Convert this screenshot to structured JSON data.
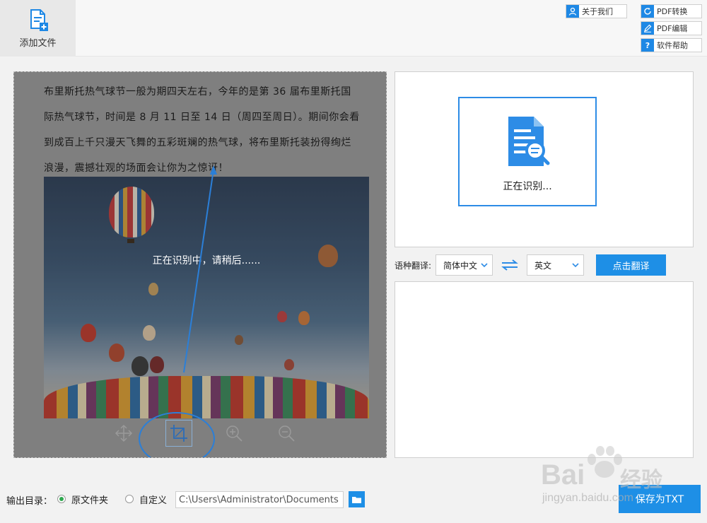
{
  "toolbar": {
    "add_file_label": "添加文件",
    "about_label": "关于我们",
    "pdf_convert_label": "PDF转换",
    "pdf_edit_label": "PDF编辑",
    "help_label": "软件帮助",
    "help_icon_glyph": "?"
  },
  "document": {
    "lines": [
      "布里斯托热气球节一般为期四天左右，今年的是第 36 届布里斯托国",
      "际热气球节，时间是 8 月 11 日至 14 日（周四至周日）。期间你会看",
      "到成百上千只漫天飞舞的五彩斑斓的热气球，将布里斯托装扮得绚烂",
      "浪漫，震撼壮观的场面会让你为之惊讶！"
    ],
    "processing_text": "正在识别中，请稍后......"
  },
  "result": {
    "recognizing_label": "正在识别..."
  },
  "translate": {
    "label": "语种翻译:",
    "source_lang": "简体中文",
    "target_lang": "英文",
    "button_label": "点击翻译"
  },
  "output": {
    "label": "输出目录：",
    "option_original": "原文件夹",
    "option_custom": "自定义",
    "path": "C:\\Users\\Administrator\\Documents",
    "save_label": "保存为TXT"
  },
  "watermark": {
    "brand": "Bai",
    "brand_cn": "经验",
    "url": "jingyan.baidu.com"
  },
  "colors": {
    "accent": "#1e8fe6",
    "annotation": "#2b7fd8",
    "radio_selected": "#2ea84f"
  }
}
